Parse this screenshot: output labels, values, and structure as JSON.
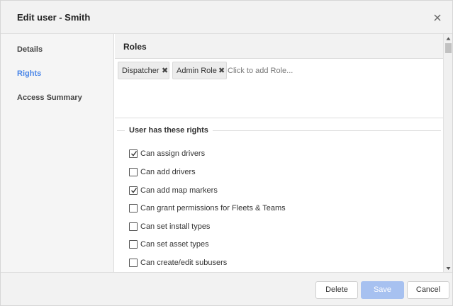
{
  "dialog": {
    "title": "Edit user - Smith",
    "close_icon": "close-icon"
  },
  "sidebar": {
    "items": [
      {
        "label": "Details",
        "active": false
      },
      {
        "label": "Rights",
        "active": true
      },
      {
        "label": "Access Summary",
        "active": false
      }
    ]
  },
  "roles": {
    "title": "Roles",
    "chips": [
      {
        "label": "Dispatcher",
        "remove_icon": "remove-x-icon"
      },
      {
        "label": "Admin Role",
        "remove_icon": "remove-x-icon"
      }
    ],
    "input_placeholder": "Click to add Role..."
  },
  "rights": {
    "title": "User has these rights",
    "items": [
      {
        "label": "Can assign drivers",
        "checked": true
      },
      {
        "label": "Can add drivers",
        "checked": false
      },
      {
        "label": "Can add map markers",
        "checked": true
      },
      {
        "label": "Can grant permissions for Fleets & Teams",
        "checked": false
      },
      {
        "label": "Can set install types",
        "checked": false
      },
      {
        "label": "Can set asset types",
        "checked": false
      },
      {
        "label": "Can create/edit subusers",
        "checked": false
      }
    ]
  },
  "footer": {
    "delete_label": "Delete",
    "save_label": "Save",
    "cancel_label": "Cancel"
  },
  "colors": {
    "accent": "#4a86e8",
    "save_disabled": "#a7c1f0",
    "header_bg": "#f2f2f2"
  }
}
